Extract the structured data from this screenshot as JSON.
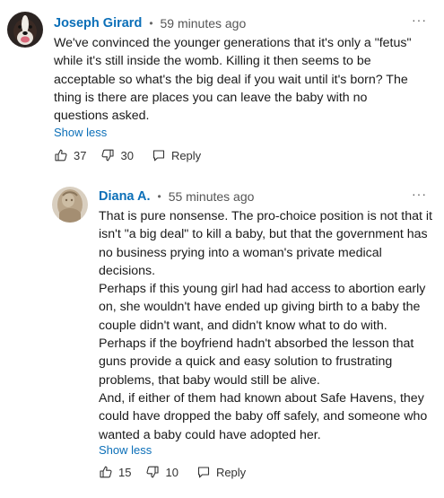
{
  "comments": [
    {
      "author": "Joseph Girard",
      "time": "59 minutes ago",
      "more": "···",
      "paragraphs": [
        "We've convinced the younger generations that it's only a \"fetus\" while it's still inside the womb. Killing it then seems to be acceptable so what's the big deal if you wait until it's born? The thing is there are places you can leave the baby with no questions asked."
      ],
      "show_less": "Show less",
      "likes": "37",
      "dislikes": "30",
      "reply": "Reply",
      "avatar_icon": "dog-avatar"
    },
    {
      "author": "Diana A.",
      "time": "55 minutes ago",
      "more": "···",
      "paragraphs": [
        "That is pure nonsense. The pro-choice position is not that it isn't \"a big deal\" to kill a baby, but that the government has no business prying into a woman's private medical decisions.",
        "Perhaps if this young girl had had access to abortion early on, she wouldn't have ended up giving birth to a baby the couple didn't want, and didn't know what to do with.",
        "Perhaps if the boyfriend hadn't absorbed the lesson that guns provide a quick and easy solution to frustrating problems, that baby would still be alive.",
        "And, if either of them had known about Safe Havens, they could have dropped the baby off safely, and someone who wanted a baby could have adopted her."
      ],
      "show_less": "Show less",
      "likes": "15",
      "dislikes": "10",
      "reply": "Reply",
      "avatar_icon": "statue-avatar"
    }
  ],
  "colors": {
    "author": "#0b6fb8",
    "link": "#0b6fb8",
    "text": "#1a1a1a",
    "meta": "#555555"
  }
}
